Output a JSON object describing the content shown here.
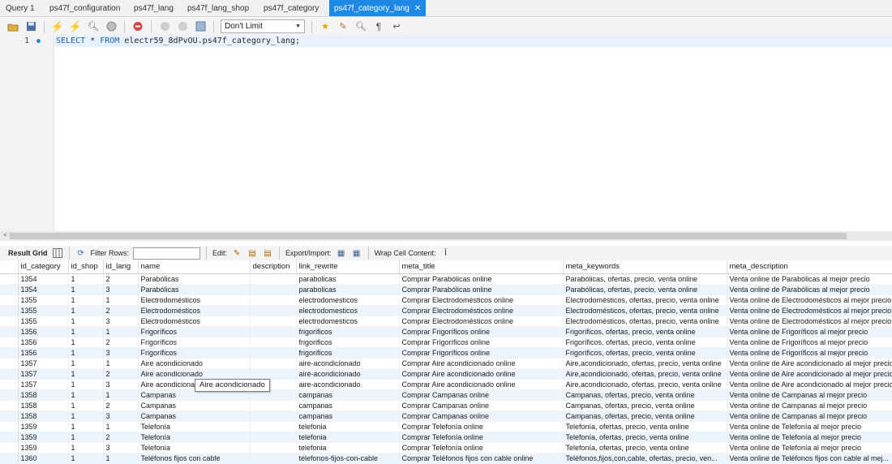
{
  "tabs": [
    {
      "label": "Query 1",
      "active": false
    },
    {
      "label": "ps47f_configuration",
      "active": false
    },
    {
      "label": "ps47f_lang",
      "active": false
    },
    {
      "label": "ps47f_lang_shop",
      "active": false
    },
    {
      "label": "ps47f_category",
      "active": false
    },
    {
      "label": "ps47f_category_lang",
      "active": true
    }
  ],
  "toolbar": {
    "limit_value": "Don't Limit"
  },
  "editor": {
    "line_number": "1",
    "sql_keyword1": "SELECT",
    "sql_star": "*",
    "sql_keyword2": "FROM",
    "sql_target": "electr59_8dPvOU.ps47f_category_lang;"
  },
  "result_toolbar": {
    "result_grid": "Result Grid",
    "filter_rows": "Filter Rows:",
    "edit": "Edit:",
    "export_import": "Export/Import:",
    "wrap_cell": "Wrap Cell Content:"
  },
  "grid": {
    "columns": [
      "id_category",
      "id_shop",
      "id_lang",
      "name",
      "description",
      "link_rewrite",
      "meta_title",
      "meta_keywords",
      "meta_description"
    ],
    "rows": [
      [
        "1354",
        "1",
        "2",
        "Parabólicas",
        "",
        "parabolicas",
        "Comprar Parabólicas online",
        "Parabólicas, ofertas, precio, venta online",
        "Venta online de Parabólicas al mejor precio"
      ],
      [
        "1354",
        "1",
        "3",
        "Parabólicas",
        "",
        "parabolicas",
        "Comprar Parabólicas online",
        "Parabólicas, ofertas, precio, venta online",
        "Venta online de Parabólicas al mejor precio"
      ],
      [
        "1355",
        "1",
        "1",
        "Electrodomésticos",
        "",
        "electrodomesticos",
        "Comprar Electrodomésticos online",
        "Electrodomésticos, ofertas, precio, venta online",
        "Venta online de Electrodomésticos al mejor precio"
      ],
      [
        "1355",
        "1",
        "2",
        "Electrodomésticos",
        "",
        "electrodomesticos",
        "Comprar Electrodomésticos online",
        "Electrodomésticos, ofertas, precio, venta online",
        "Venta online de Electrodomésticos al mejor precio"
      ],
      [
        "1355",
        "1",
        "3",
        "Electrodomésticos",
        "",
        "electrodomesticos",
        "Comprar Electrodomésticos online",
        "Electrodomésticos, ofertas, precio, venta online",
        "Venta online de Electrodomésticos al mejor precio"
      ],
      [
        "1356",
        "1",
        "1",
        "Frigoríficos",
        "",
        "frigorificos",
        "Comprar Frigoríficos online",
        "Frigoríficos, ofertas, precio, venta online",
        "Venta online de Frigoríficos al mejor precio"
      ],
      [
        "1356",
        "1",
        "2",
        "Frigoríficos",
        "",
        "frigorificos",
        "Comprar Frigoríficos online",
        "Frigoríficos, ofertas, precio, venta online",
        "Venta online de Frigoríficos al mejor precio"
      ],
      [
        "1356",
        "1",
        "3",
        "Frigoríficos",
        "",
        "frigorificos",
        "Comprar Frigoríficos online",
        "Frigoríficos, ofertas, precio, venta online",
        "Venta online de Frigoríficos al mejor precio"
      ],
      [
        "1357",
        "1",
        "1",
        "Aire acondicionado",
        "",
        "aire-acondicionado",
        "Comprar Aire acondicionado online",
        "Aire,acondicionado, ofertas, precio, venta online",
        "Venta online de Aire acondicionado al mejor precio"
      ],
      [
        "1357",
        "1",
        "2",
        "Aire acondicionado",
        "",
        "aire-acondicionado",
        "Comprar Aire acondicionado online",
        "Aire,acondicionado, ofertas, precio, venta online",
        "Venta online de Aire acondicionado al mejor precio"
      ],
      [
        "1357",
        "1",
        "3",
        "Aire acondicionado",
        "",
        "aire-acondicionado",
        "Comprar Aire acondicionado online",
        "Aire,acondicionado, ofertas, precio, venta online",
        "Venta online de Aire acondicionado al mejor precio"
      ],
      [
        "1358",
        "1",
        "1",
        "Campanas",
        "",
        "campanas",
        "Comprar Campanas online",
        "Campanas, ofertas, precio, venta online",
        "Venta online de Campanas al mejor precio"
      ],
      [
        "1358",
        "1",
        "2",
        "Campanas",
        "",
        "campanas",
        "Comprar Campanas online",
        "Campanas, ofertas, precio, venta online",
        "Venta online de Campanas al mejor precio"
      ],
      [
        "1358",
        "1",
        "3",
        "Campanas",
        "",
        "campanas",
        "Comprar Campanas online",
        "Campanas, ofertas, precio, venta online",
        "Venta online de Campanas al mejor precio"
      ],
      [
        "1359",
        "1",
        "1",
        "Telefonía",
        "",
        "telefonia",
        "Comprar Telefonía online",
        "Telefonía, ofertas, precio, venta online",
        "Venta online de Telefonía al mejor precio"
      ],
      [
        "1359",
        "1",
        "2",
        "Telefonía",
        "",
        "telefonia",
        "Comprar Telefonía online",
        "Telefonía, ofertas, precio, venta online",
        "Venta online de Telefonía al mejor precio"
      ],
      [
        "1359",
        "1",
        "3",
        "Telefonía",
        "",
        "telefonia",
        "Comprar Telefonía online",
        "Telefonía, ofertas, precio, venta online",
        "Venta online de Telefonía al mejor precio"
      ],
      [
        "1360",
        "1",
        "1",
        "Teléfonos fijos con cable",
        "",
        "telefonos-fijos-con-cable",
        "Comprar Teléfonos fijos con cable online",
        "Teléfonos,fijos,con,cable, ofertas, precio, ven...",
        "Venta online de Teléfonos fijos con cable al mej..."
      ]
    ]
  },
  "tooltip": "Aire acondicionado"
}
